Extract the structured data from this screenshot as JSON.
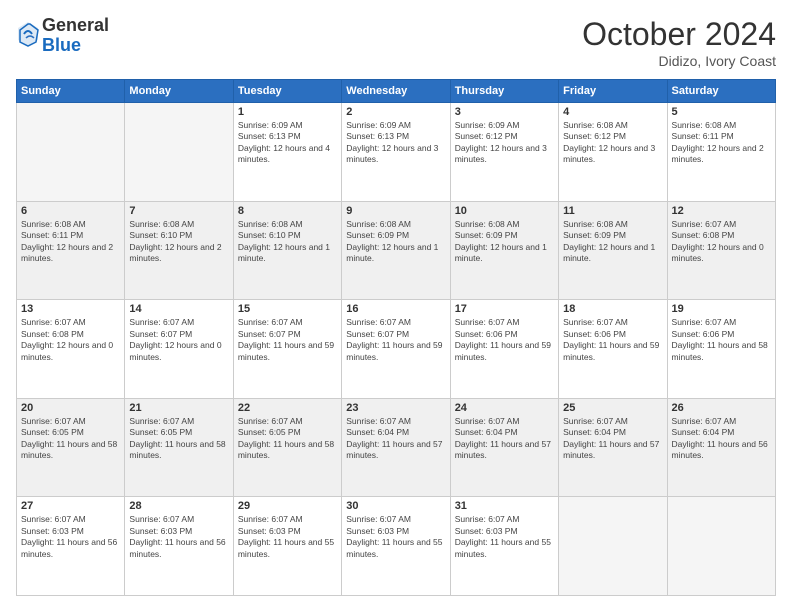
{
  "logo": {
    "general": "General",
    "blue": "Blue"
  },
  "header": {
    "month": "October 2024",
    "location": "Didizo, Ivory Coast"
  },
  "weekdays": [
    "Sunday",
    "Monday",
    "Tuesday",
    "Wednesday",
    "Thursday",
    "Friday",
    "Saturday"
  ],
  "weeks": [
    [
      {
        "day": "",
        "empty": true
      },
      {
        "day": "",
        "empty": true
      },
      {
        "day": "1",
        "sunrise": "Sunrise: 6:09 AM",
        "sunset": "Sunset: 6:13 PM",
        "daylight": "Daylight: 12 hours and 4 minutes."
      },
      {
        "day": "2",
        "sunrise": "Sunrise: 6:09 AM",
        "sunset": "Sunset: 6:13 PM",
        "daylight": "Daylight: 12 hours and 3 minutes."
      },
      {
        "day": "3",
        "sunrise": "Sunrise: 6:09 AM",
        "sunset": "Sunset: 6:12 PM",
        "daylight": "Daylight: 12 hours and 3 minutes."
      },
      {
        "day": "4",
        "sunrise": "Sunrise: 6:08 AM",
        "sunset": "Sunset: 6:12 PM",
        "daylight": "Daylight: 12 hours and 3 minutes."
      },
      {
        "day": "5",
        "sunrise": "Sunrise: 6:08 AM",
        "sunset": "Sunset: 6:11 PM",
        "daylight": "Daylight: 12 hours and 2 minutes."
      }
    ],
    [
      {
        "day": "6",
        "sunrise": "Sunrise: 6:08 AM",
        "sunset": "Sunset: 6:11 PM",
        "daylight": "Daylight: 12 hours and 2 minutes."
      },
      {
        "day": "7",
        "sunrise": "Sunrise: 6:08 AM",
        "sunset": "Sunset: 6:10 PM",
        "daylight": "Daylight: 12 hours and 2 minutes."
      },
      {
        "day": "8",
        "sunrise": "Sunrise: 6:08 AM",
        "sunset": "Sunset: 6:10 PM",
        "daylight": "Daylight: 12 hours and 1 minute."
      },
      {
        "day": "9",
        "sunrise": "Sunrise: 6:08 AM",
        "sunset": "Sunset: 6:09 PM",
        "daylight": "Daylight: 12 hours and 1 minute."
      },
      {
        "day": "10",
        "sunrise": "Sunrise: 6:08 AM",
        "sunset": "Sunset: 6:09 PM",
        "daylight": "Daylight: 12 hours and 1 minute."
      },
      {
        "day": "11",
        "sunrise": "Sunrise: 6:08 AM",
        "sunset": "Sunset: 6:09 PM",
        "daylight": "Daylight: 12 hours and 1 minute."
      },
      {
        "day": "12",
        "sunrise": "Sunrise: 6:07 AM",
        "sunset": "Sunset: 6:08 PM",
        "daylight": "Daylight: 12 hours and 0 minutes."
      }
    ],
    [
      {
        "day": "13",
        "sunrise": "Sunrise: 6:07 AM",
        "sunset": "Sunset: 6:08 PM",
        "daylight": "Daylight: 12 hours and 0 minutes."
      },
      {
        "day": "14",
        "sunrise": "Sunrise: 6:07 AM",
        "sunset": "Sunset: 6:07 PM",
        "daylight": "Daylight: 12 hours and 0 minutes."
      },
      {
        "day": "15",
        "sunrise": "Sunrise: 6:07 AM",
        "sunset": "Sunset: 6:07 PM",
        "daylight": "Daylight: 11 hours and 59 minutes."
      },
      {
        "day": "16",
        "sunrise": "Sunrise: 6:07 AM",
        "sunset": "Sunset: 6:07 PM",
        "daylight": "Daylight: 11 hours and 59 minutes."
      },
      {
        "day": "17",
        "sunrise": "Sunrise: 6:07 AM",
        "sunset": "Sunset: 6:06 PM",
        "daylight": "Daylight: 11 hours and 59 minutes."
      },
      {
        "day": "18",
        "sunrise": "Sunrise: 6:07 AM",
        "sunset": "Sunset: 6:06 PM",
        "daylight": "Daylight: 11 hours and 59 minutes."
      },
      {
        "day": "19",
        "sunrise": "Sunrise: 6:07 AM",
        "sunset": "Sunset: 6:06 PM",
        "daylight": "Daylight: 11 hours and 58 minutes."
      }
    ],
    [
      {
        "day": "20",
        "sunrise": "Sunrise: 6:07 AM",
        "sunset": "Sunset: 6:05 PM",
        "daylight": "Daylight: 11 hours and 58 minutes."
      },
      {
        "day": "21",
        "sunrise": "Sunrise: 6:07 AM",
        "sunset": "Sunset: 6:05 PM",
        "daylight": "Daylight: 11 hours and 58 minutes."
      },
      {
        "day": "22",
        "sunrise": "Sunrise: 6:07 AM",
        "sunset": "Sunset: 6:05 PM",
        "daylight": "Daylight: 11 hours and 58 minutes."
      },
      {
        "day": "23",
        "sunrise": "Sunrise: 6:07 AM",
        "sunset": "Sunset: 6:04 PM",
        "daylight": "Daylight: 11 hours and 57 minutes."
      },
      {
        "day": "24",
        "sunrise": "Sunrise: 6:07 AM",
        "sunset": "Sunset: 6:04 PM",
        "daylight": "Daylight: 11 hours and 57 minutes."
      },
      {
        "day": "25",
        "sunrise": "Sunrise: 6:07 AM",
        "sunset": "Sunset: 6:04 PM",
        "daylight": "Daylight: 11 hours and 57 minutes."
      },
      {
        "day": "26",
        "sunrise": "Sunrise: 6:07 AM",
        "sunset": "Sunset: 6:04 PM",
        "daylight": "Daylight: 11 hours and 56 minutes."
      }
    ],
    [
      {
        "day": "27",
        "sunrise": "Sunrise: 6:07 AM",
        "sunset": "Sunset: 6:03 PM",
        "daylight": "Daylight: 11 hours and 56 minutes."
      },
      {
        "day": "28",
        "sunrise": "Sunrise: 6:07 AM",
        "sunset": "Sunset: 6:03 PM",
        "daylight": "Daylight: 11 hours and 56 minutes."
      },
      {
        "day": "29",
        "sunrise": "Sunrise: 6:07 AM",
        "sunset": "Sunset: 6:03 PM",
        "daylight": "Daylight: 11 hours and 55 minutes."
      },
      {
        "day": "30",
        "sunrise": "Sunrise: 6:07 AM",
        "sunset": "Sunset: 6:03 PM",
        "daylight": "Daylight: 11 hours and 55 minutes."
      },
      {
        "day": "31",
        "sunrise": "Sunrise: 6:07 AM",
        "sunset": "Sunset: 6:03 PM",
        "daylight": "Daylight: 11 hours and 55 minutes."
      },
      {
        "day": "",
        "empty": true
      },
      {
        "day": "",
        "empty": true
      }
    ]
  ]
}
